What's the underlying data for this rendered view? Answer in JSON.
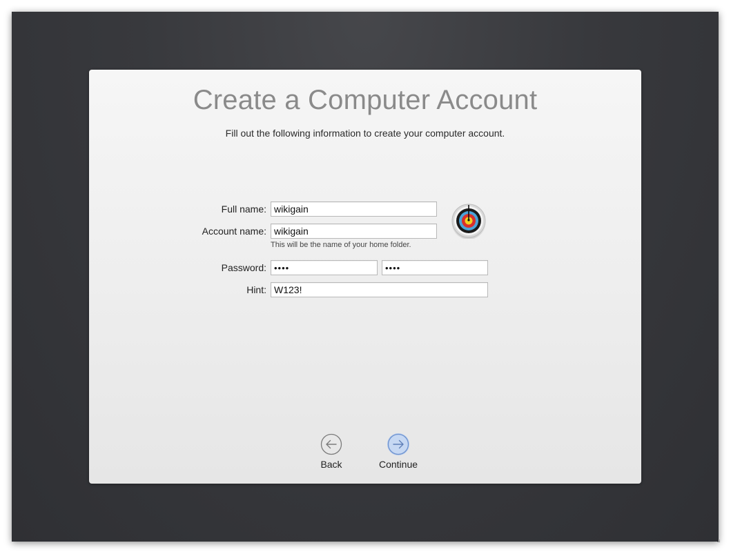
{
  "title": "Create a Computer Account",
  "subtitle": "Fill out the following information to create your computer account.",
  "form": {
    "full_name": {
      "label": "Full name:",
      "value": "wikigain"
    },
    "account_name": {
      "label": "Account name:",
      "value": "wikigain",
      "help": "This will be the name of your home folder."
    },
    "password": {
      "label": "Password:",
      "value": "••••",
      "verify_value": "••••"
    },
    "hint": {
      "label": "Hint:",
      "value": "W123!"
    }
  },
  "avatar": {
    "icon": "archery-target-icon"
  },
  "nav": {
    "back_label": "Back",
    "back_icon": "arrow-left-circle-icon",
    "continue_label": "Continue",
    "continue_icon": "arrow-right-circle-icon"
  },
  "colors": {
    "background": "#38393d",
    "panel": "#eeeeee",
    "title": "#8a8a8a",
    "continue_accent": "#5a8fd8"
  }
}
